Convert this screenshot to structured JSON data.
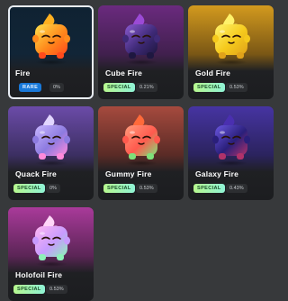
{
  "pets": [
    {
      "name": "Fire",
      "badge": "RARE",
      "chance": "0%",
      "selected": true,
      "bg_top": "#0f2232",
      "bg_mid": "#112537",
      "body": [
        "#ffe04a",
        "#ff8a1c",
        "#ff4b1c"
      ],
      "flame": "#ffb020"
    },
    {
      "name": "Cube Fire",
      "badge": "SPECIAL",
      "chance": "0.21%",
      "selected": false,
      "bg_top": "#6a2a7e",
      "bg_mid": "#41204e",
      "body": [
        "#8a5ad0",
        "#3f2a78",
        "#1e1740"
      ],
      "flame": "#9b4ad6"
    },
    {
      "name": "Gold Fire",
      "badge": "SPECIAL",
      "chance": "0.53%",
      "selected": false,
      "bg_top": "#d39a1e",
      "bg_mid": "#7a5715",
      "body": [
        "#fff36a",
        "#f5c91c",
        "#e0a21a"
      ],
      "flame": "#fff26a"
    },
    {
      "name": "Quack Fire",
      "badge": "SPECIAL",
      "chance": "0%",
      "selected": false,
      "bg_top": "#6b4ba8",
      "bg_mid": "#3c2f62",
      "body": [
        "#c8b6ff",
        "#8d7be0",
        "#ff8adb"
      ],
      "flame": "#e2d6ff"
    },
    {
      "name": "Gummy Fire",
      "badge": "SPECIAL",
      "chance": "0.53%",
      "selected": false,
      "bg_top": "#a64a3e",
      "bg_mid": "#5a2b26",
      "body": [
        "#ff9b7b",
        "#ff5a4e",
        "#7ee07a"
      ],
      "flame": "#ff6a3a"
    },
    {
      "name": "Galaxy Fire",
      "badge": "SPECIAL",
      "chance": "0.43%",
      "selected": false,
      "bg_top": "#4634a2",
      "bg_mid": "#2b235e",
      "body": [
        "#6a56e0",
        "#2a1f7a",
        "#b0326a"
      ],
      "flame": "#4a2fb0"
    },
    {
      "name": "Holofoil Fire",
      "badge": "SPECIAL",
      "chance": "0.53%",
      "selected": false,
      "bg_top": "#a93a9a",
      "bg_mid": "#5b2556",
      "body": [
        "#ffb6f0",
        "#c79bff",
        "#8df0b8"
      ],
      "flame": "#ffd6f8"
    }
  ]
}
